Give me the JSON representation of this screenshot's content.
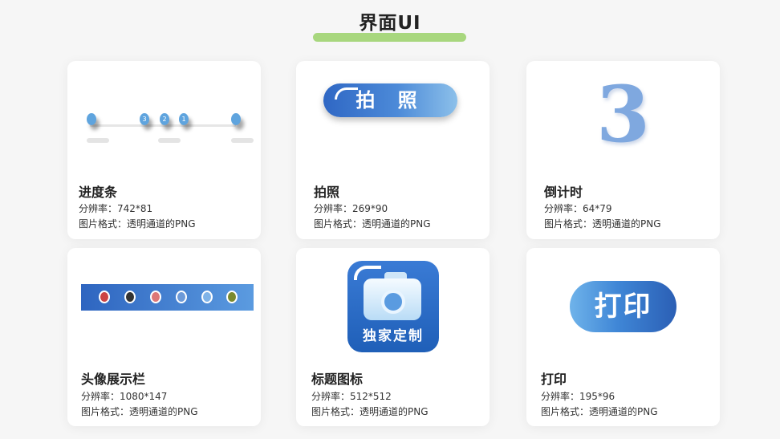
{
  "page": {
    "title": "界面UI"
  },
  "cards": [
    {
      "name": "进度条",
      "resolution": "分辨率：742*81",
      "format": "图片格式：透明通道的PNG",
      "steps": [
        "3",
        "2",
        "1"
      ]
    },
    {
      "name": "拍照",
      "resolution": "分辨率：269*90",
      "format": "图片格式：透明通道的PNG",
      "button_text": "拍 照"
    },
    {
      "name": "倒计时",
      "resolution": "分辨率：64*79",
      "format": "图片格式：透明通道的PNG",
      "digit": "3"
    },
    {
      "name": "头像展示栏",
      "resolution": "分辨率：1080*147",
      "format": "图片格式：透明通道的PNG"
    },
    {
      "name": "标题图标",
      "resolution": "分辨率：512*512",
      "format": "图片格式：透明通道的PNG",
      "icon_text": "独家定制"
    },
    {
      "name": "打印",
      "resolution": "分辨率：195*96",
      "format": "图片格式：透明通道的PNG",
      "button_text": "打印"
    }
  ],
  "colors": {
    "accent": "#a8d77e",
    "brand_blue": "#2f67c4"
  },
  "icons": [
    "camera-icon"
  ]
}
